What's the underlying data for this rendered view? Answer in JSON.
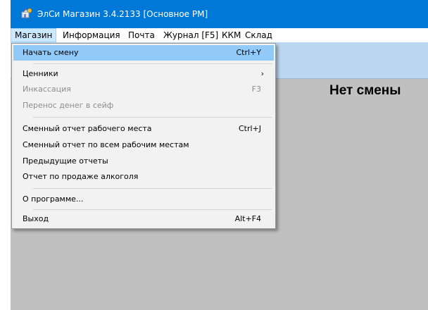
{
  "window": {
    "title": "ЭлСи Магазин 3.4.2133 [Основное РМ]"
  },
  "menubar": {
    "items": [
      {
        "label": "Магазин"
      },
      {
        "label": "Информация"
      },
      {
        "label": "Почта"
      },
      {
        "label": "Журнал [F5]"
      },
      {
        "label": "ККМ"
      },
      {
        "label": "Склад"
      }
    ]
  },
  "dropdown": {
    "items": [
      {
        "label": "Начать смену",
        "shortcut": "Ctrl+Y"
      },
      {
        "label": "Ценники",
        "submenu": "›"
      },
      {
        "label": "Инкассация",
        "shortcut": "F3"
      },
      {
        "label": "Перенос денег в сейф"
      },
      {
        "label": "Сменный отчет рабочего места",
        "shortcut": "Ctrl+J"
      },
      {
        "label": "Сменный отчет по всем рабочим местам"
      },
      {
        "label": "Предыдущие отчеты"
      },
      {
        "label": "Отчет по продаже алкоголя"
      },
      {
        "label": "О программе..."
      },
      {
        "label": "Выход",
        "shortcut": "Alt+F4"
      }
    ]
  },
  "main": {
    "status": "Нет смены"
  },
  "colors": {
    "titlebar": "#0078d7",
    "menu_highlight": "#91c9f7",
    "workspace": "#c0c0c0",
    "toolbar": "#bcd7ef"
  }
}
